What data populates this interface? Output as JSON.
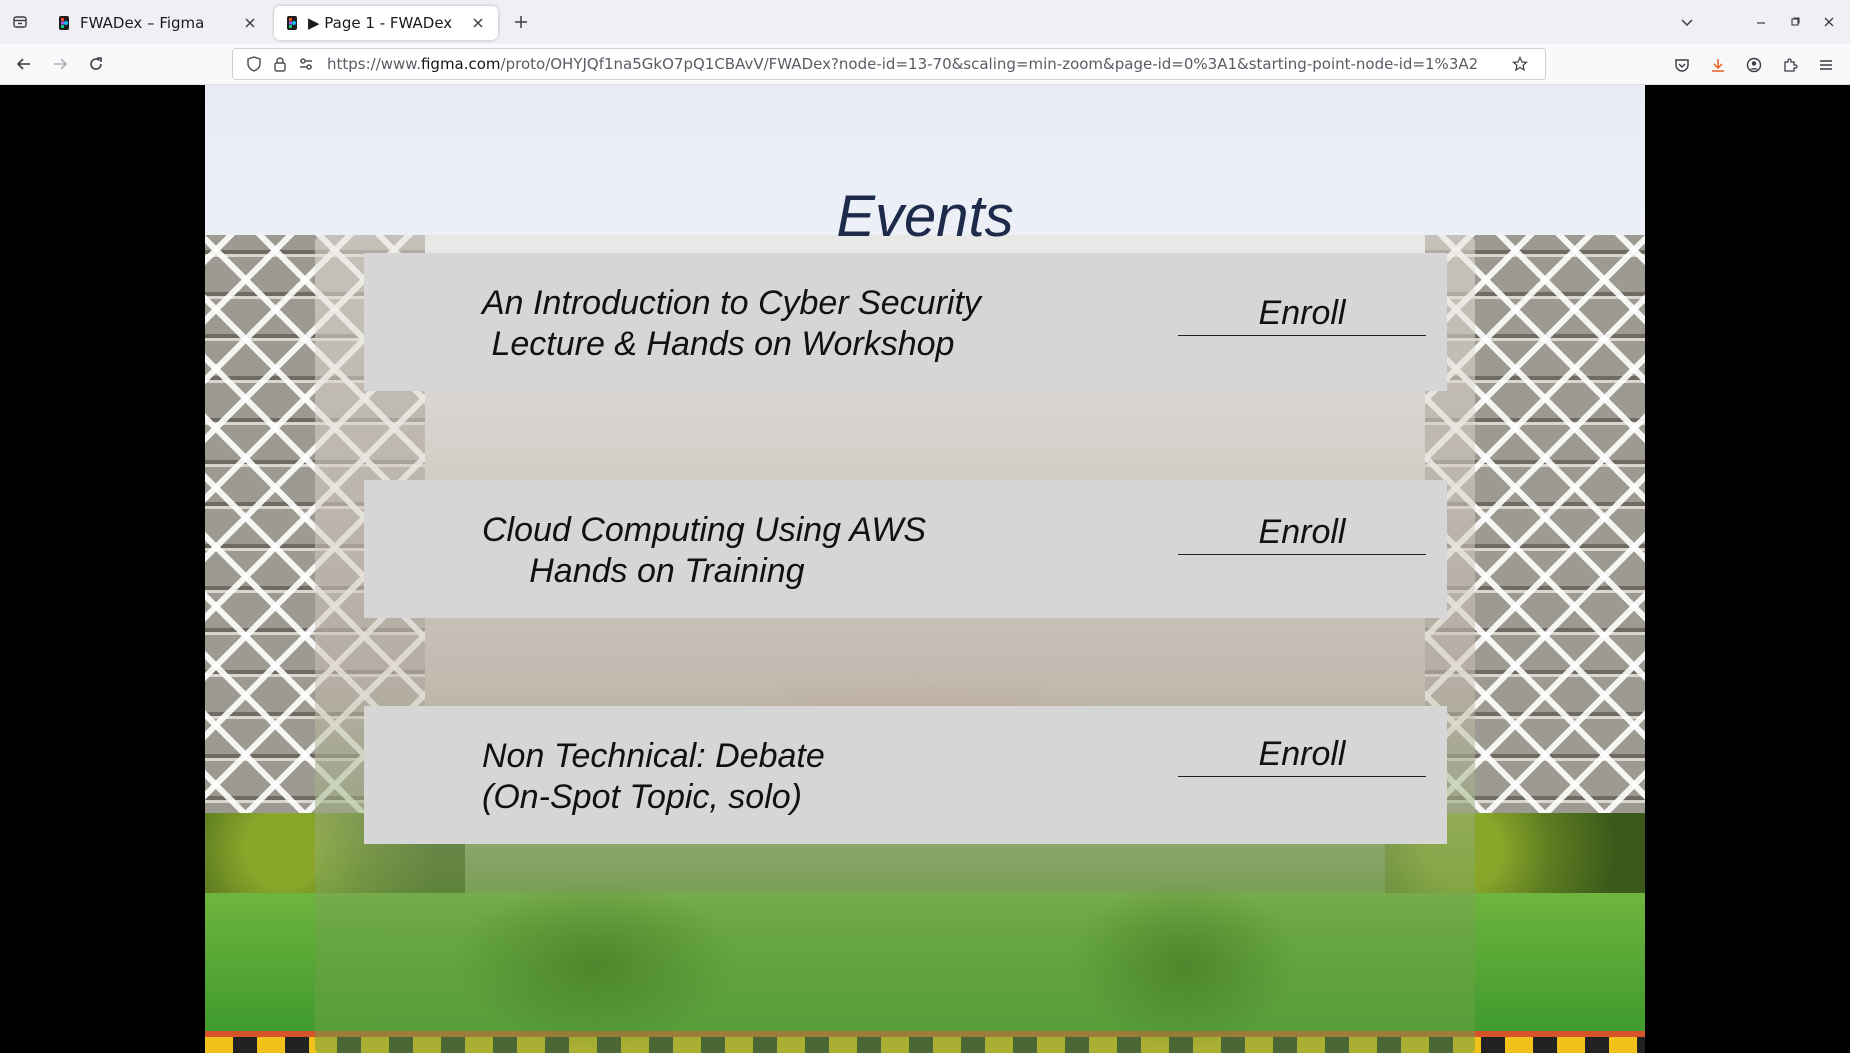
{
  "browser": {
    "tabs": [
      {
        "title": "FWADex – Figma",
        "active": false
      },
      {
        "title": "▶ Page 1 - FWADex",
        "active": true
      }
    ],
    "url_prefix": "https://www.",
    "url_host": "figma.com",
    "url_rest": "/proto/OHYJQf1na5GkO7pQ1CBAvV/FWADex?node-id=13-70&scaling=min-zoom&page-id=0%3A1&starting-point-node-id=1%3A2"
  },
  "page": {
    "title": "Events",
    "events": [
      {
        "title": "An Introduction to Cyber Security\n Lecture & Hands on Workshop",
        "button": "Enroll"
      },
      {
        "title": "Cloud Computing Using AWS\n     Hands on Training",
        "button": "Enroll"
      },
      {
        "title": "Non Technical: Debate\n(On-Spot Topic, solo)",
        "button": "Enroll"
      }
    ]
  },
  "colors": {
    "title_color": "#1e2a4a",
    "card_bg": "#d6d6d6",
    "favicon_figma": "#f24e1e"
  }
}
